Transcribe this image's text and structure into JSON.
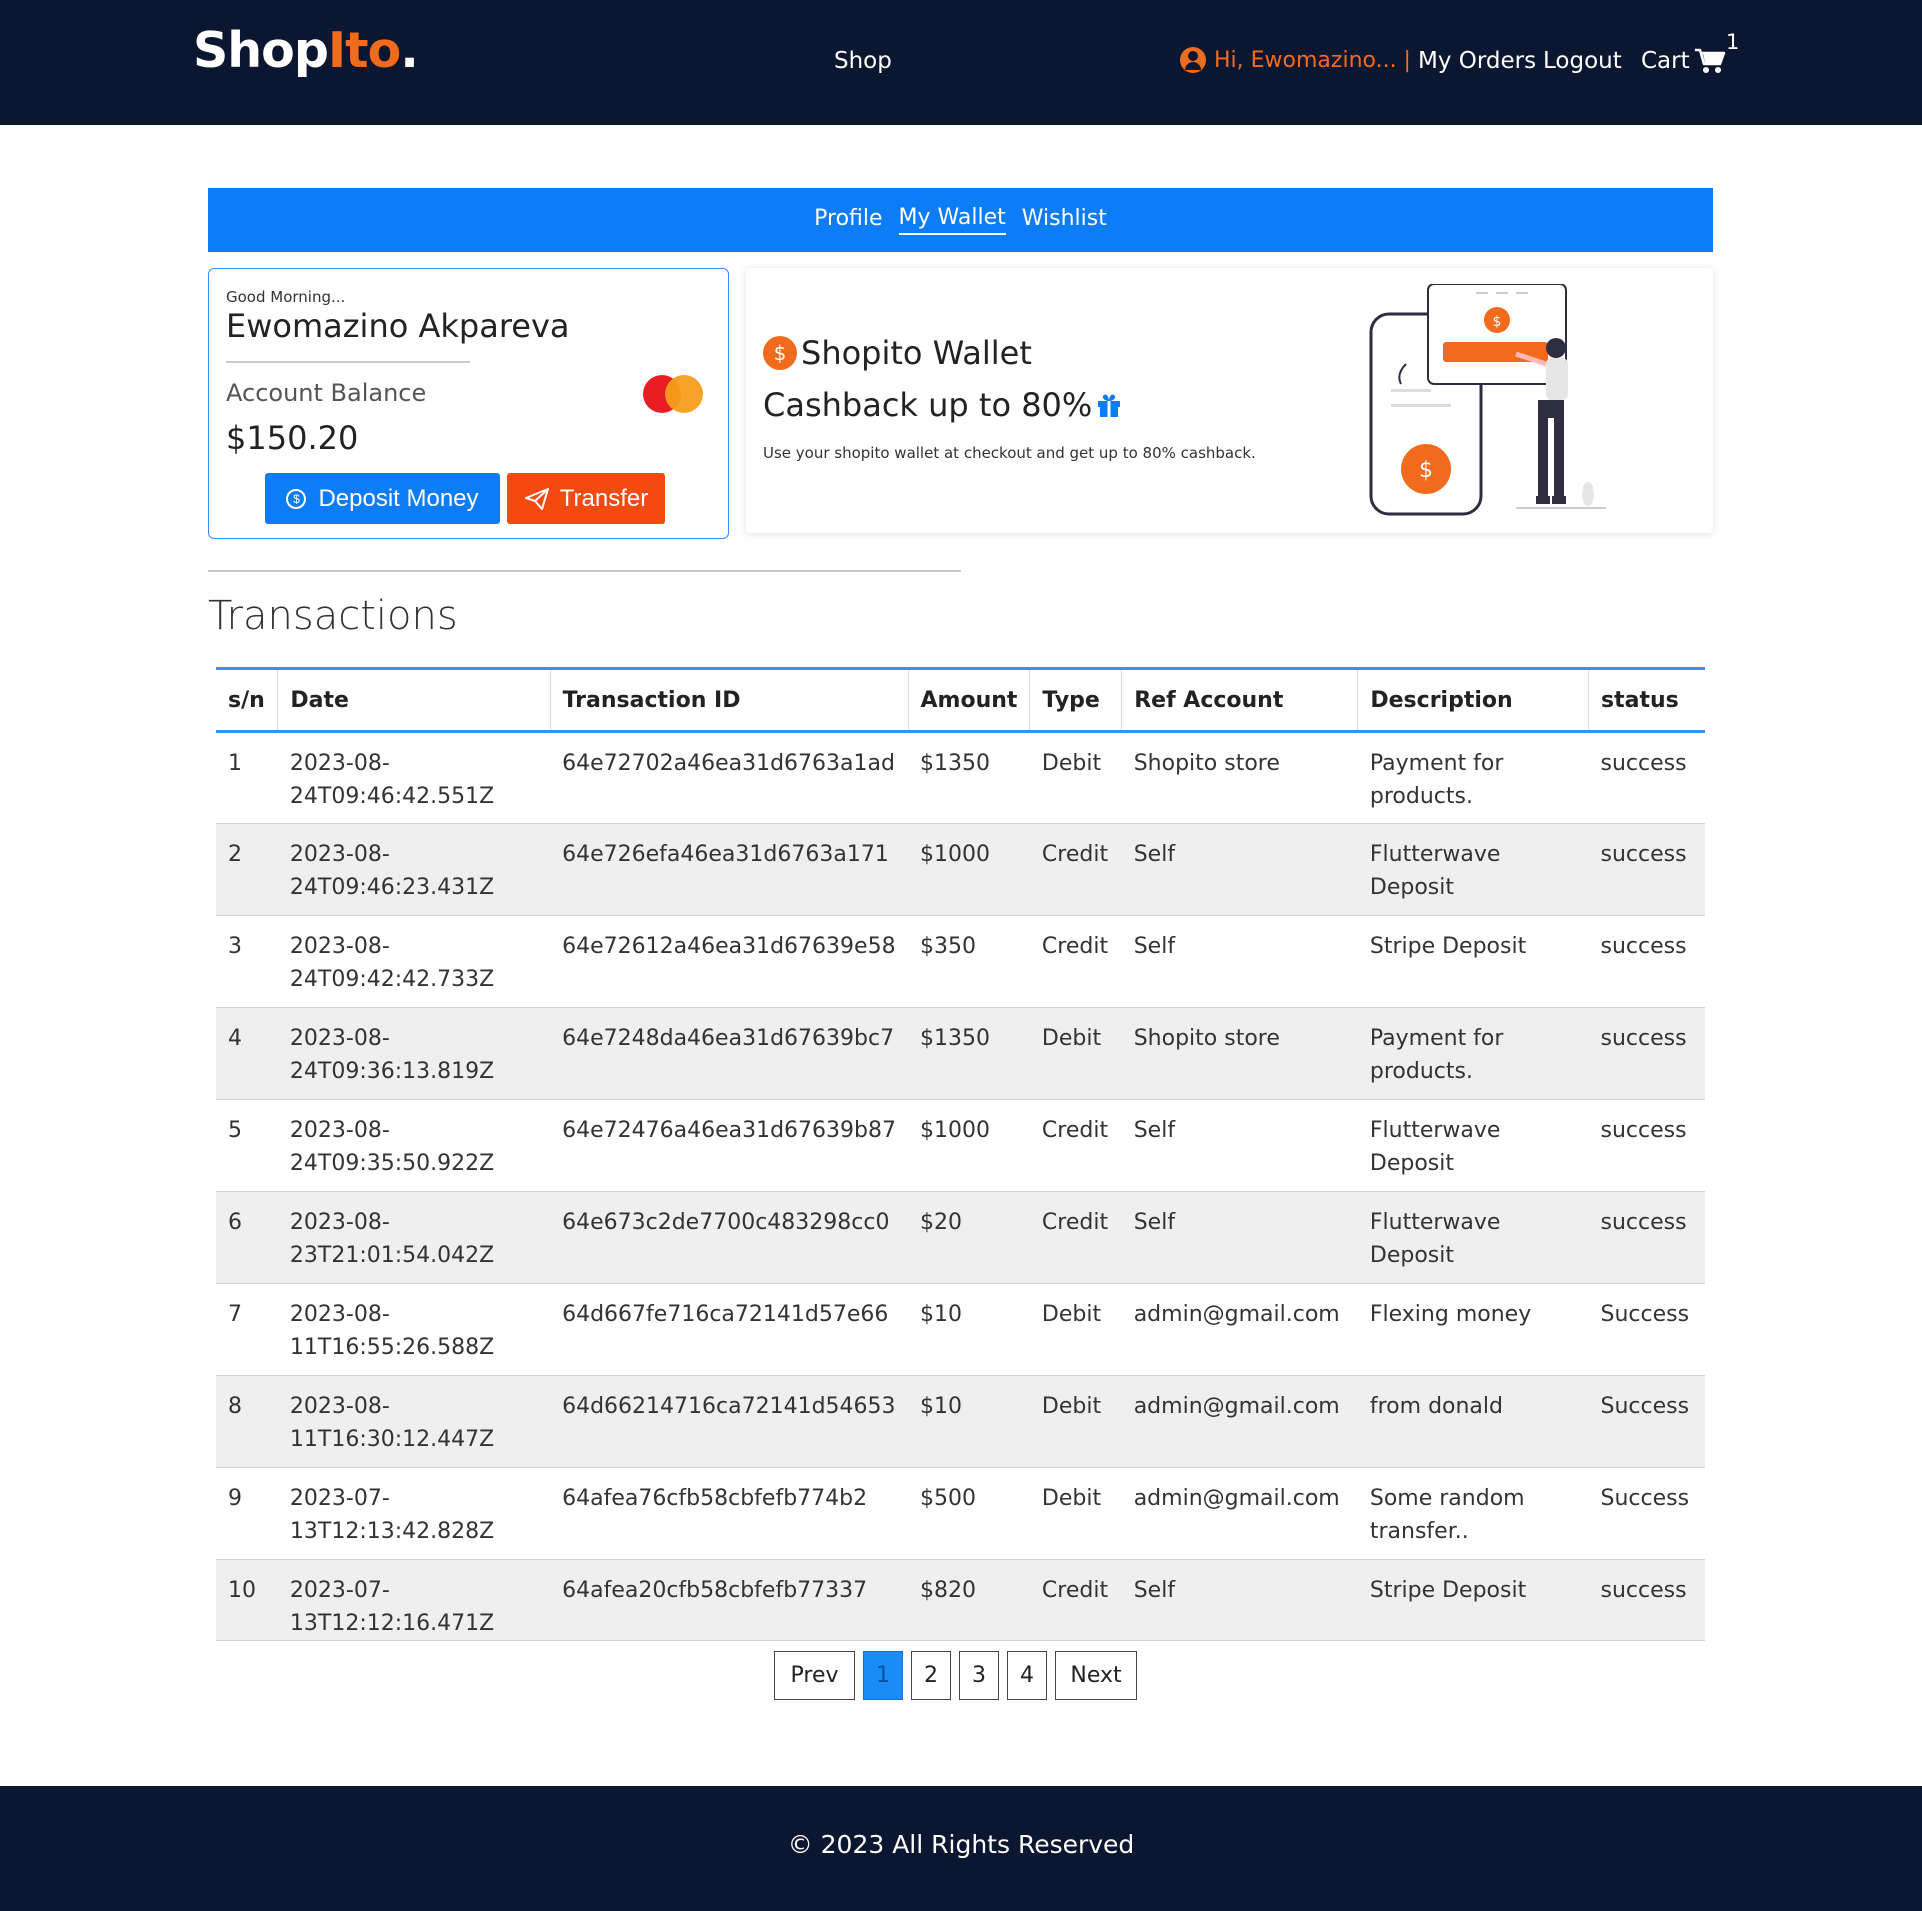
{
  "header": {
    "logo_main": "Shop",
    "logo_accent": "Ito",
    "logo_dot": ".",
    "nav_shop": "Shop",
    "greeting": "Hi, Ewomazino... |",
    "nav_orders": "My Orders",
    "nav_logout": "Logout",
    "nav_cart": "Cart",
    "cart_count": "1"
  },
  "tabs": [
    {
      "label": "Profile",
      "active": false
    },
    {
      "label": "My Wallet",
      "active": true
    },
    {
      "label": "Wishlist",
      "active": false
    }
  ],
  "account": {
    "greeting": "Good Morning...",
    "name": "Ewomazino Akpareva",
    "balance_label": "Account Balance",
    "balance": "$150.20",
    "deposit_label": "Deposit Money",
    "transfer_label": "Transfer"
  },
  "promo": {
    "title": "Shopito Wallet",
    "subtitle": "Cashback up to 80%",
    "description": "Use your shopito wallet at checkout and get up to 80% cashback."
  },
  "transactions": {
    "heading": "Transactions",
    "columns": [
      "s/n",
      "Date",
      "Transaction ID",
      "Amount",
      "Type",
      "Ref Account",
      "Description",
      "status"
    ],
    "rows": [
      {
        "sn": "1",
        "date_a": "2023-08-",
        "date_b": "24T09:46:42.551Z",
        "id": "64e72702a46ea31d6763a1ad",
        "amount": "$1350",
        "type": "Debit",
        "ref": "Shopito store",
        "desc_a": "Payment for",
        "desc_b": "products.",
        "status": "success"
      },
      {
        "sn": "2",
        "date_a": "2023-08-",
        "date_b": "24T09:46:23.431Z",
        "id": "64e726efa46ea31d6763a171",
        "amount": "$1000",
        "type": "Credit",
        "ref": "Self",
        "desc_a": "Flutterwave",
        "desc_b": "Deposit",
        "status": "success"
      },
      {
        "sn": "3",
        "date_a": "2023-08-",
        "date_b": "24T09:42:42.733Z",
        "id": "64e72612a46ea31d67639e58",
        "amount": "$350",
        "type": "Credit",
        "ref": "Self",
        "desc_a": "Stripe Deposit",
        "desc_b": "",
        "status": "success"
      },
      {
        "sn": "4",
        "date_a": "2023-08-",
        "date_b": "24T09:36:13.819Z",
        "id": "64e7248da46ea31d67639bc7",
        "amount": "$1350",
        "type": "Debit",
        "ref": "Shopito store",
        "desc_a": "Payment for",
        "desc_b": "products.",
        "status": "success"
      },
      {
        "sn": "5",
        "date_a": "2023-08-",
        "date_b": "24T09:35:50.922Z",
        "id": "64e72476a46ea31d67639b87",
        "amount": "$1000",
        "type": "Credit",
        "ref": "Self",
        "desc_a": "Flutterwave",
        "desc_b": "Deposit",
        "status": "success"
      },
      {
        "sn": "6",
        "date_a": "2023-08-",
        "date_b": "23T21:01:54.042Z",
        "id": "64e673c2de7700c483298cc0",
        "amount": "$20",
        "type": "Credit",
        "ref": "Self",
        "desc_a": "Flutterwave",
        "desc_b": "Deposit",
        "status": "success"
      },
      {
        "sn": "7",
        "date_a": "2023-08-",
        "date_b": "11T16:55:26.588Z",
        "id": "64d667fe716ca72141d57e66",
        "amount": "$10",
        "type": "Debit",
        "ref": "admin@gmail.com",
        "desc_a": "Flexing money",
        "desc_b": "",
        "status": "Success"
      },
      {
        "sn": "8",
        "date_a": "2023-08-",
        "date_b": "11T16:30:12.447Z",
        "id": "64d66214716ca72141d54653",
        "amount": "$10",
        "type": "Debit",
        "ref": "admin@gmail.com",
        "desc_a": "from donald",
        "desc_b": "",
        "status": "Success"
      },
      {
        "sn": "9",
        "date_a": "2023-07-",
        "date_b": "13T12:13:42.828Z",
        "id": "64afea76cfb58cbfefb774b2",
        "amount": "$500",
        "type": "Debit",
        "ref": "admin@gmail.com",
        "desc_a": "Some random",
        "desc_b": "transfer..",
        "status": "Success"
      },
      {
        "sn": "10",
        "date_a": "2023-07-13T12:12:16.471Z",
        "date_b": "",
        "id": "64afea20cfb58cbfefb77337",
        "amount": "$820",
        "type": "Credit",
        "ref": "Self",
        "desc_a": "Stripe Deposit",
        "desc_b": "",
        "status": "success"
      }
    ]
  },
  "pagination": {
    "prev": "Prev",
    "pages": [
      "1",
      "2",
      "3",
      "4"
    ],
    "current": "1",
    "next": "Next"
  },
  "footer": {
    "text": "© 2023 All Rights Reserved"
  },
  "colors": {
    "navy": "#0b1730",
    "brand_orange": "#f26b1d",
    "primary_blue": "#0d7cf7",
    "transfer_orange": "#f54a0f"
  }
}
